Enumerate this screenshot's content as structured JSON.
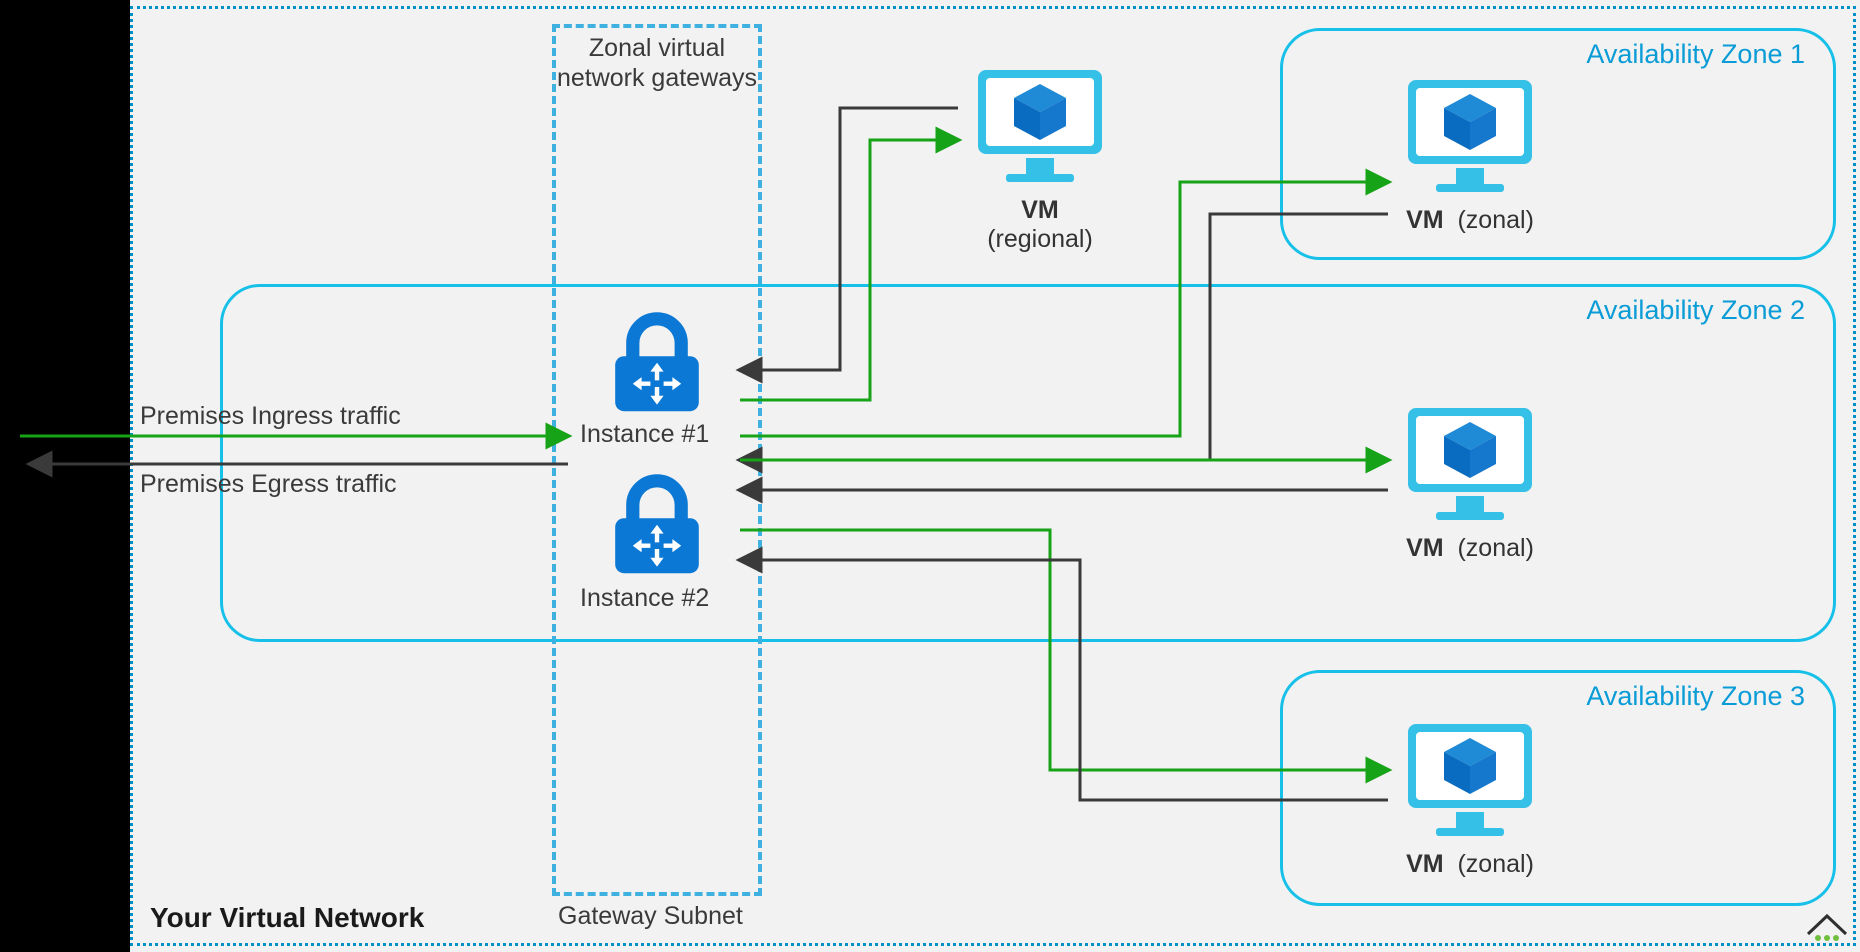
{
  "vnet_label": "Your Virtual Network",
  "subnet_label": "Gateway Subnet",
  "subnet_title_line1": "Zonal virtual",
  "subnet_title_line2": "network gateways",
  "instance1": "Instance #1",
  "instance2": "Instance #2",
  "ingress": "Premises Ingress traffic",
  "egress": "Premises Egress traffic",
  "vm_regional_name": "VM",
  "vm_regional_scope": "(regional)",
  "vm_zonal_name": "VM",
  "vm_zonal_scope": "(zonal)",
  "az1": "Availability Zone 1",
  "az2": "Availability Zone 2",
  "az3": "Availability Zone 3"
}
